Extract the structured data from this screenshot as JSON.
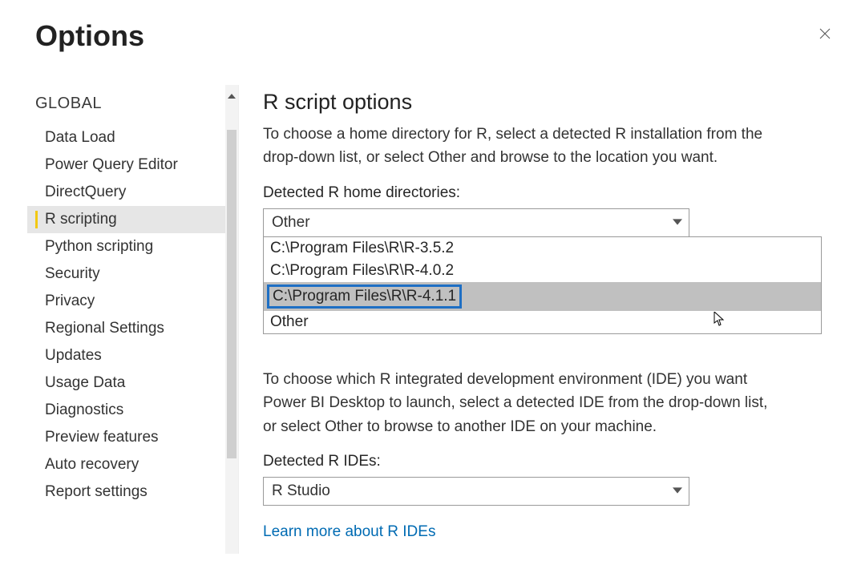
{
  "window": {
    "title": "Options"
  },
  "sidebar": {
    "section_label": "GLOBAL",
    "selected_index": 3,
    "items": [
      {
        "label": "Data Load"
      },
      {
        "label": "Power Query Editor"
      },
      {
        "label": "DirectQuery"
      },
      {
        "label": "R scripting"
      },
      {
        "label": "Python scripting"
      },
      {
        "label": "Security"
      },
      {
        "label": "Privacy"
      },
      {
        "label": "Regional Settings"
      },
      {
        "label": "Updates"
      },
      {
        "label": "Usage Data"
      },
      {
        "label": "Diagnostics"
      },
      {
        "label": "Preview features"
      },
      {
        "label": "Auto recovery"
      },
      {
        "label": "Report settings"
      }
    ]
  },
  "main": {
    "heading": "R script options",
    "intro": "To choose a home directory for R, select a detected R installation from the drop-down list, or select Other and browse to the location you want.",
    "home_dirs_label": "Detected R home directories:",
    "home_dirs_value": "Other",
    "home_dirs_options": [
      "C:\\Program Files\\R\\R-3.5.2",
      "C:\\Program Files\\R\\R-4.0.2",
      "C:\\Program Files\\R\\R-4.1.1",
      "Other"
    ],
    "home_dirs_hover_index": 2,
    "ide_paragraph": "To choose which R integrated development environment (IDE) you want Power BI Desktop to launch, select a detected IDE from the drop-down list, or select Other to browse to another IDE on your machine.",
    "ide_label": "Detected R IDEs:",
    "ide_value": "R Studio",
    "learn_more": "Learn more about R IDEs"
  }
}
